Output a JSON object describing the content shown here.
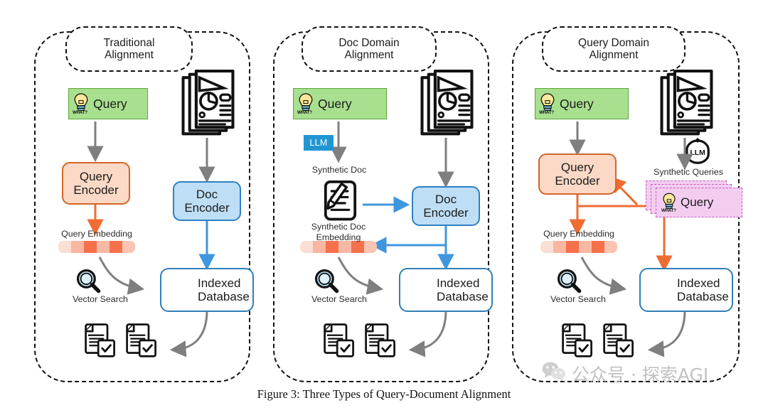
{
  "figure": {
    "caption": "Figure 3: Three Types of Query-Document Alignment",
    "watermark": "公众号 · 探索AGI"
  },
  "colors": {
    "query_green_fill": "#a8e08f",
    "query_green_stroke": "#5aa83a",
    "query_encoder_fill": "#fbd9c6",
    "query_encoder_stroke": "#d2662a",
    "doc_encoder_fill": "#bedef5",
    "doc_encoder_stroke": "#2f80c4",
    "database_stroke": "#2f7fb5",
    "llm_badge_blue": "#2196d3",
    "synthetic_query_fill": "#f3cdf0",
    "synthetic_query_stroke": "#c45fc4",
    "arrow_grey": "#7f7f7f",
    "arrow_blue": "#3f97dd",
    "arrow_orange": "#ef6c33",
    "embedding_segments": [
      "#fbded4",
      "#f9b6a0",
      "#f4714c",
      "#f8b9a4",
      "#f4714c",
      "#f9c4b2"
    ]
  },
  "panels": [
    {
      "id": "traditional",
      "title": "Traditional\nAlignment",
      "title_line1": "Traditional",
      "title_line2": "Alignment",
      "nodes": {
        "query": "Query",
        "query_badge": "WHAT?",
        "query_encoder": "Query\nEncoder",
        "query_encoder_line1": "Query",
        "query_encoder_line2": "Encoder",
        "doc_encoder_line1": "Doc",
        "doc_encoder_line2": "Encoder",
        "query_embedding_label": "Query Embedding",
        "vector_search_label": "Vector Search",
        "database_line1": "Indexed",
        "database_line2": "Database"
      },
      "icons": [
        "lightbulb-icon",
        "documents-stack-icon",
        "magnifier-icon",
        "database-icon",
        "retrieved-documents-icon"
      ]
    },
    {
      "id": "doc-domain",
      "title_line1": "Doc Domain",
      "title_line2": "Alignment",
      "nodes": {
        "query": "Query",
        "query_badge": "WHAT?",
        "llm_badge": "LLM",
        "synthetic_doc_label": "Synthetic Doc",
        "synthetic_doc_embedding_line1": "Synthetic Doc",
        "synthetic_doc_embedding_line2": "Embedding",
        "doc_encoder_line1": "Doc",
        "doc_encoder_line2": "Encoder",
        "vector_search_label": "Vector Search",
        "database_line1": "Indexed",
        "database_line2": "Database"
      },
      "icons": [
        "lightbulb-icon",
        "documents-stack-icon",
        "document-pencil-icon",
        "magnifier-icon",
        "database-icon",
        "retrieved-documents-icon"
      ]
    },
    {
      "id": "query-domain",
      "title_line1": "Query Domain",
      "title_line2": "Alignment",
      "nodes": {
        "query": "Query",
        "query_badge": "WHAT?",
        "query_encoder_line1": "Query",
        "query_encoder_line2": "Encoder",
        "llm_badge": "LLM",
        "synthetic_queries_label": "Synthetic Queries",
        "synthetic_query_card": "Query",
        "synthetic_query_card_badge": "WHAT?",
        "query_embedding_label": "Query Embedding",
        "vector_search_label": "Vector Search",
        "database_line1": "Indexed",
        "database_line2": "Database"
      },
      "icons": [
        "lightbulb-icon",
        "documents-stack-icon",
        "llm-circle-icon",
        "magnifier-icon",
        "database-icon",
        "retrieved-documents-icon"
      ]
    }
  ]
}
